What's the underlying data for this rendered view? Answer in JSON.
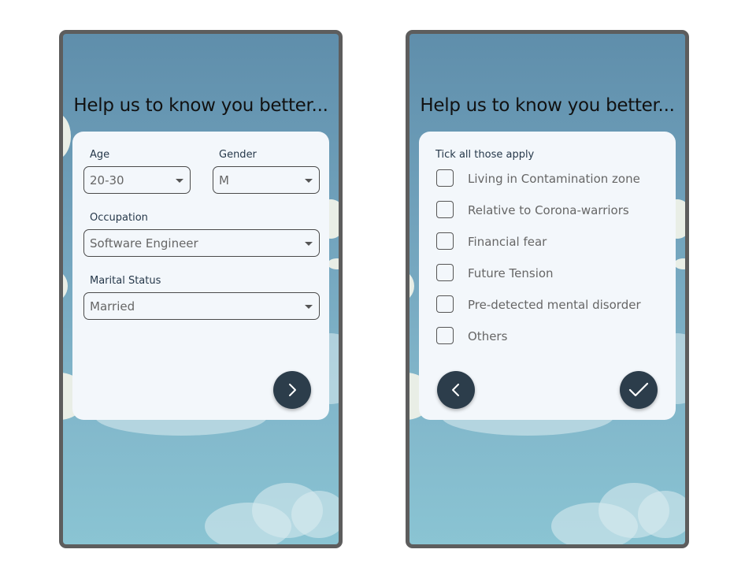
{
  "screen1": {
    "title": "Help us to know you better...",
    "age": {
      "label": "Age",
      "value": "20-30"
    },
    "gender": {
      "label": "Gender",
      "value": "M"
    },
    "occupation": {
      "label": "Occupation",
      "value": "Software Engineer"
    },
    "marital": {
      "label": "Marital Status",
      "value": "Married"
    },
    "next_icon": "chevron-right-icon"
  },
  "screen2": {
    "title": "Help us to know you better...",
    "instruction": "Tick all those apply",
    "options": [
      "Living in Contamination zone",
      "Relative to Corona-warriors",
      "Financial fear",
      "Future Tension",
      "Pre-detected mental disorder",
      "Others"
    ],
    "back_icon": "chevron-left-icon",
    "submit_icon": "checkmark-icon"
  },
  "colors": {
    "button": "#2c3d4b",
    "card": "#f3f7fb",
    "sky_top": "#5f8eab",
    "sky_bottom": "#8ac4d3"
  }
}
